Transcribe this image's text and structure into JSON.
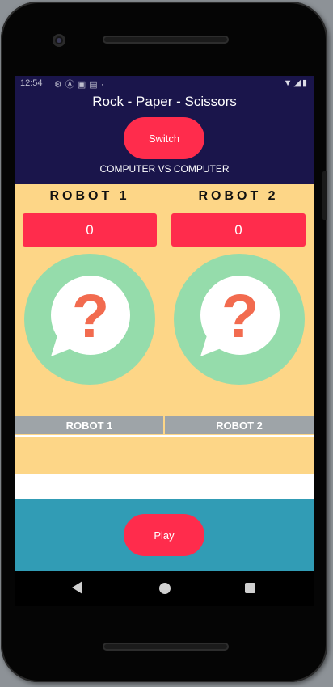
{
  "status_bar": {
    "time": "12:54",
    "left_icons": [
      "gear-icon",
      "a-icon",
      "photo-icon",
      "lock-icon",
      "dot-icon"
    ],
    "right_icons": [
      "wifi-icon",
      "signal-icon",
      "battery-icon"
    ]
  },
  "header": {
    "title": "Rock - Paper - Scissors",
    "switch_label": "Switch",
    "mode_text": "COMPUTER VS COMPUTER"
  },
  "players": [
    {
      "name": "ROBOT 1",
      "score": "0",
      "result_label": "ROBOT 1"
    },
    {
      "name": "ROBOT 2",
      "score": "0",
      "result_label": "ROBOT 2"
    }
  ],
  "footer": {
    "play_label": "Play"
  },
  "colors": {
    "header_bg": "#1a154b",
    "game_bg": "#fdd687",
    "accent": "#ff2c4c",
    "footer_bg": "#319cb5",
    "avatar_ring": "#95dcab",
    "question_mark": "#f26b4f",
    "result_bar": "#9ea4a8"
  }
}
